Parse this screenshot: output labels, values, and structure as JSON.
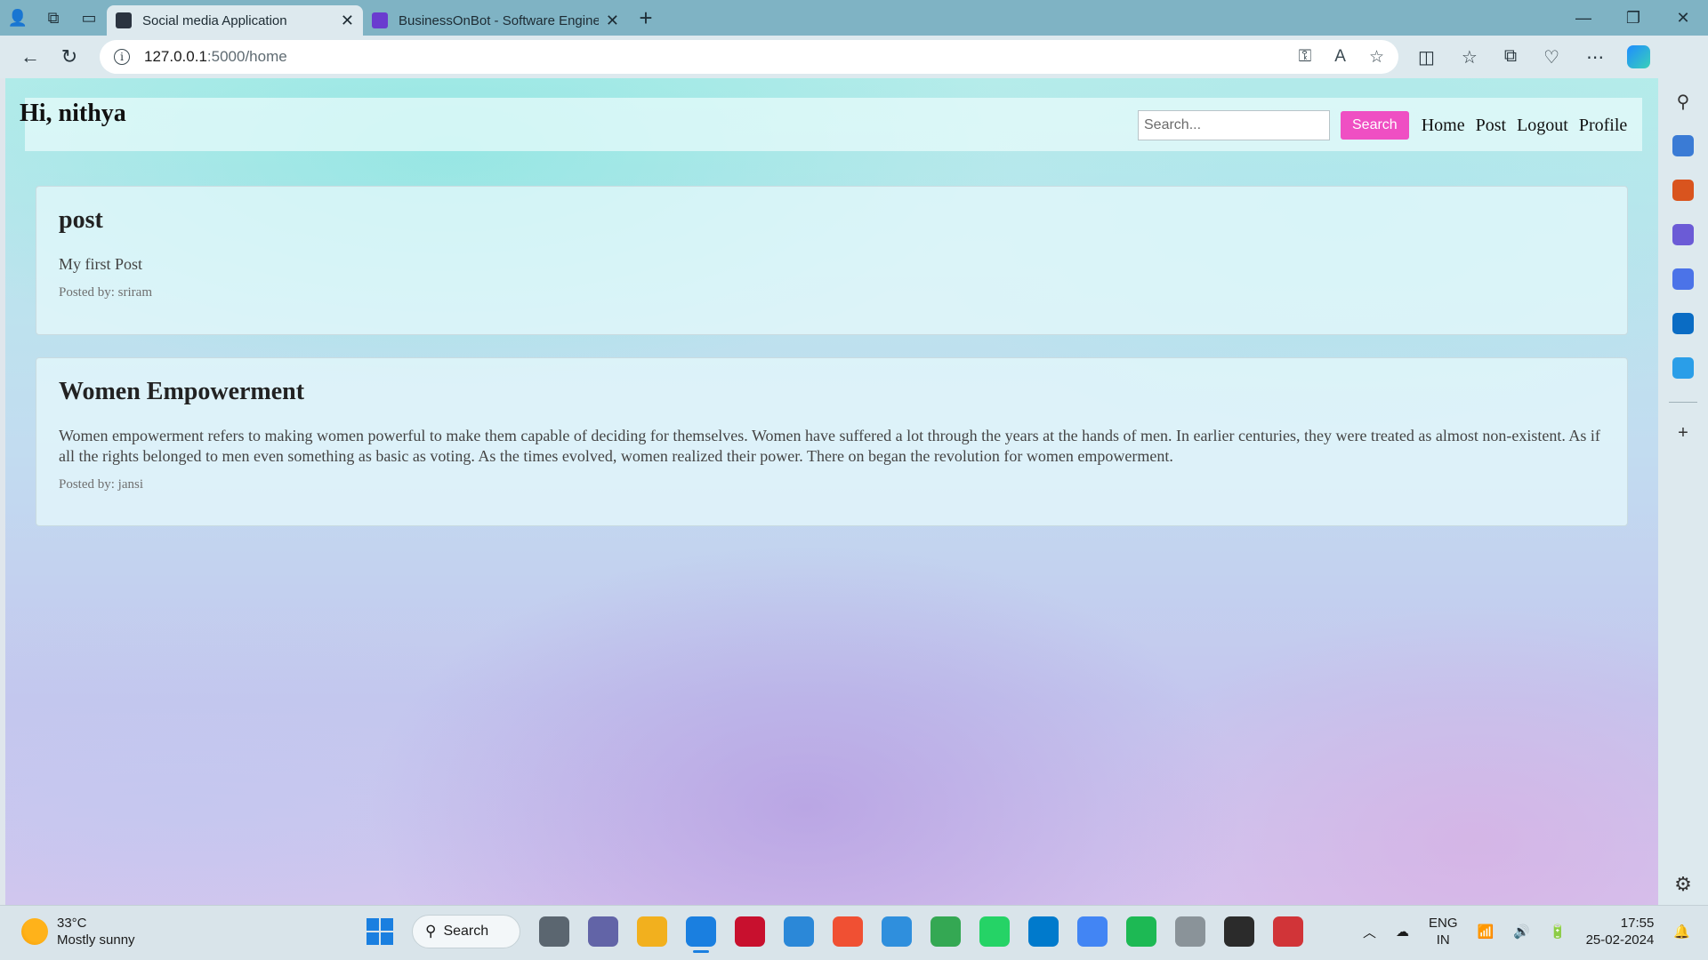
{
  "browser": {
    "tabs": [
      {
        "title": "Social media Application",
        "active": true,
        "favicon_color": "#2b3440"
      },
      {
        "title": "BusinessOnBot - Software Engine",
        "active": false,
        "favicon_color": "#6a3ccf"
      }
    ],
    "address": {
      "host": "127.0.0.1",
      "path": ":5000/home"
    }
  },
  "page": {
    "greeting": "Hi, nithya",
    "search": {
      "placeholder": "Search...",
      "button": "Search"
    },
    "nav": [
      "Home",
      "Post",
      "Logout",
      "Profile"
    ],
    "posts": [
      {
        "title": "post",
        "body": "My first Post",
        "byline": "Posted by: sriram"
      },
      {
        "title": "Women Empowerment",
        "body": "Women empowerment refers to making women powerful to make them capable of deciding for themselves. Women have suffered a lot through the years at the hands of men. In earlier centuries, they were treated as almost non-existent. As if all the rights belonged to men even something as basic as voting. As the times evolved, women realized their power. There on began the revolution for women empowerment.",
        "byline": "Posted by: jansi"
      }
    ],
    "accent_color": "#ef4fc3"
  },
  "taskbar": {
    "weather": {
      "temp": "33°C",
      "condition": "Mostly sunny"
    },
    "search_label": "Search",
    "apps": [
      {
        "name": "task-view",
        "color": "#5b6670"
      },
      {
        "name": "teams-chat",
        "color": "#6264a7"
      },
      {
        "name": "file-explorer",
        "color": "#f2b01e"
      },
      {
        "name": "edge",
        "color": "#1a7fe0",
        "active": true
      },
      {
        "name": "mcafee",
        "color": "#c8102e"
      },
      {
        "name": "ms-store",
        "color": "#2b88d8"
      },
      {
        "name": "git",
        "color": "#f05033"
      },
      {
        "name": "help",
        "color": "#2f8fdd"
      },
      {
        "name": "chrome",
        "color": "#34a853"
      },
      {
        "name": "whatsapp",
        "color": "#25d366"
      },
      {
        "name": "vscode",
        "color": "#007acc"
      },
      {
        "name": "chrome-profile",
        "color": "#4285f4"
      },
      {
        "name": "spotify",
        "color": "#1db954"
      },
      {
        "name": "database",
        "color": "#8a9399"
      },
      {
        "name": "media-player",
        "color": "#2b2b2b"
      },
      {
        "name": "snipping-tool",
        "color": "#d13438"
      }
    ],
    "language": {
      "line1": "ENG",
      "line2": "IN"
    },
    "clock": {
      "time": "17:55",
      "date": "25-02-2024"
    }
  }
}
